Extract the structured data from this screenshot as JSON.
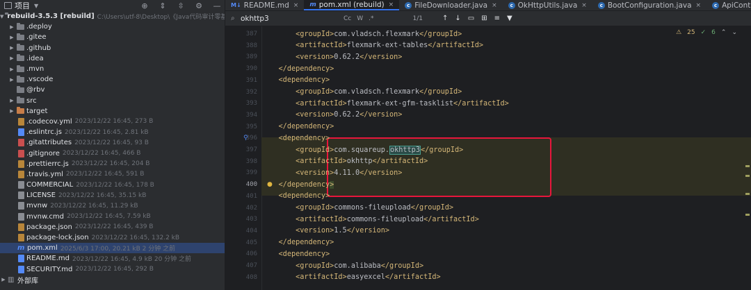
{
  "project_panel": {
    "title": "项目",
    "root": {
      "name": "rebuild-3.5.3 [rebuild]",
      "path": "C:\\Users\\utf-8\\Desktop\\《Java代码审计零基"
    },
    "items": [
      {
        "name": ".deploy",
        "kind": "folder",
        "meta": ""
      },
      {
        "name": ".gitee",
        "kind": "folder",
        "meta": ""
      },
      {
        "name": ".github",
        "kind": "folder",
        "meta": ""
      },
      {
        "name": ".idea",
        "kind": "folder",
        "meta": ""
      },
      {
        "name": ".mvn",
        "kind": "folder",
        "meta": ""
      },
      {
        "name": ".vscode",
        "kind": "folder",
        "meta": ""
      },
      {
        "name": "@rbv",
        "kind": "folder",
        "meta": ""
      },
      {
        "name": "src",
        "kind": "folder",
        "meta": ""
      },
      {
        "name": "target",
        "kind": "folder-orange",
        "meta": ""
      },
      {
        "name": ".codecov.yml",
        "kind": "file",
        "meta": "2023/12/22 16:45, 273 B"
      },
      {
        "name": ".eslintrc.js",
        "kind": "file",
        "meta": "2023/12/22 16:45, 2.81 kB"
      },
      {
        "name": ".gitattributes",
        "kind": "file",
        "meta": "2023/12/22 16:45, 93 B"
      },
      {
        "name": ".gitignore",
        "kind": "file",
        "meta": "2023/12/22 16:45, 466 B"
      },
      {
        "name": ".prettierrc.js",
        "kind": "file",
        "meta": "2023/12/22 16:45, 204 B"
      },
      {
        "name": ".travis.yml",
        "kind": "file",
        "meta": "2023/12/22 16:45, 591 B"
      },
      {
        "name": "COMMERCIAL",
        "kind": "file",
        "meta": "2023/12/22 16:45, 178 B"
      },
      {
        "name": "LICENSE",
        "kind": "file",
        "meta": "2023/12/22 16:45, 35.15 kB"
      },
      {
        "name": "mvnw",
        "kind": "file",
        "meta": "2023/12/22 16:45, 11.29 kB"
      },
      {
        "name": "mvnw.cmd",
        "kind": "file",
        "meta": "2023/12/22 16:45, 7.59 kB"
      },
      {
        "name": "package.json",
        "kind": "file",
        "meta": "2023/12/22 16:45, 439 B"
      },
      {
        "name": "package-lock.json",
        "kind": "file",
        "meta": "2023/12/22 16:45, 132.2 kB"
      },
      {
        "name": "pom.xml",
        "kind": "maven",
        "meta": "2025/6/3 17:00, 20.21 kB 2 分钟 之前"
      },
      {
        "name": "README.md",
        "kind": "file",
        "meta": "2023/12/22 16:45, 4.9 kB 20 分钟 之前"
      },
      {
        "name": "SECURITY.md",
        "kind": "file",
        "meta": "2023/12/22 16:45, 292 B"
      }
    ],
    "external_libs": "外部库"
  },
  "tabs": [
    {
      "label": "README.md",
      "icon": "md",
      "active": false
    },
    {
      "label": "pom.xml (rebuild)",
      "icon": "m",
      "active": true
    },
    {
      "label": "FileDownloader.java",
      "icon": "c",
      "active": false
    },
    {
      "label": "OkHttpUtils.java",
      "icon": "c",
      "active": false
    },
    {
      "label": "BootConfiguration.java",
      "icon": "c",
      "active": false
    },
    {
      "label": "ApiContext.java",
      "icon": "c",
      "active": false
    }
  ],
  "search": {
    "query": "okhttp3",
    "count": "1/1",
    "opt_case": "Cc",
    "opt_word": "W",
    "opt_regex": ".*"
  },
  "inspections": {
    "warnings": "25",
    "ok": "6"
  },
  "editor": {
    "lines": [
      {
        "n": "387",
        "indent": 2,
        "parts": [
          [
            "t",
            "<groupId>"
          ],
          [
            "x",
            "com.vladsch.flexmark"
          ],
          [
            "t",
            "</groupId>"
          ]
        ]
      },
      {
        "n": "388",
        "indent": 2,
        "parts": [
          [
            "t",
            "<artifactId>"
          ],
          [
            "x",
            "flexmark-ext-tables"
          ],
          [
            "t",
            "</artifactId>"
          ]
        ]
      },
      {
        "n": "389",
        "indent": 2,
        "parts": [
          [
            "t",
            "<version>"
          ],
          [
            "x",
            "0.62.2"
          ],
          [
            "t",
            "</version>"
          ]
        ]
      },
      {
        "n": "390",
        "indent": 1,
        "parts": [
          [
            "t",
            "</dependency>"
          ]
        ]
      },
      {
        "n": "391",
        "indent": 1,
        "parts": [
          [
            "t",
            "<dependency>"
          ]
        ]
      },
      {
        "n": "392",
        "indent": 2,
        "parts": [
          [
            "t",
            "<groupId>"
          ],
          [
            "x",
            "com.vladsch.flexmark"
          ],
          [
            "t",
            "</groupId>"
          ]
        ]
      },
      {
        "n": "393",
        "indent": 2,
        "parts": [
          [
            "t",
            "<artifactId>"
          ],
          [
            "x",
            "flexmark-ext-gfm-tasklist"
          ],
          [
            "t",
            "</artifactId>"
          ]
        ]
      },
      {
        "n": "394",
        "indent": 2,
        "parts": [
          [
            "t",
            "<version>"
          ],
          [
            "x",
            "0.62.2"
          ],
          [
            "t",
            "</version>"
          ]
        ]
      },
      {
        "n": "395",
        "indent": 1,
        "parts": [
          [
            "t",
            "</dependency>"
          ]
        ]
      },
      {
        "n": "396",
        "indent": 1,
        "parts": [
          [
            "t",
            "<dependency>"
          ]
        ]
      },
      {
        "n": "397",
        "indent": 2,
        "parts": [
          [
            "t",
            "<groupId>"
          ],
          [
            "x",
            "com.squareup."
          ],
          [
            "m",
            "okhttp3"
          ],
          [
            "t",
            "</groupId>"
          ]
        ]
      },
      {
        "n": "398",
        "indent": 2,
        "parts": [
          [
            "t",
            "<artifactId>"
          ],
          [
            "x",
            "okhttp"
          ],
          [
            "t",
            "</artifactId>"
          ]
        ]
      },
      {
        "n": "399",
        "indent": 2,
        "parts": [
          [
            "t",
            "<version>"
          ],
          [
            "x",
            "4.11.0"
          ],
          [
            "t",
            "</version>"
          ]
        ]
      },
      {
        "n": "400",
        "indent": 1,
        "parts": [
          [
            "t",
            "</dependency"
          ],
          [
            "c",
            ">"
          ]
        ]
      },
      {
        "n": "401",
        "indent": 1,
        "parts": [
          [
            "t",
            "<dependency>"
          ]
        ]
      },
      {
        "n": "402",
        "indent": 2,
        "parts": [
          [
            "t",
            "<groupId>"
          ],
          [
            "x",
            "commons-fileupload"
          ],
          [
            "t",
            "</groupId>"
          ]
        ]
      },
      {
        "n": "403",
        "indent": 2,
        "parts": [
          [
            "t",
            "<artifactId>"
          ],
          [
            "x",
            "commons-fileupload"
          ],
          [
            "t",
            "</artifactId>"
          ]
        ]
      },
      {
        "n": "404",
        "indent": 2,
        "parts": [
          [
            "t",
            "<version>"
          ],
          [
            "x",
            "1.5"
          ],
          [
            "t",
            "</version>"
          ]
        ]
      },
      {
        "n": "405",
        "indent": 1,
        "parts": [
          [
            "t",
            "</dependency>"
          ]
        ]
      },
      {
        "n": "406",
        "indent": 1,
        "parts": [
          [
            "t",
            "<dependency>"
          ]
        ]
      },
      {
        "n": "407",
        "indent": 2,
        "parts": [
          [
            "t",
            "<groupId>"
          ],
          [
            "x",
            "com.alibaba"
          ],
          [
            "t",
            "</groupId>"
          ]
        ]
      },
      {
        "n": "408",
        "indent": 2,
        "parts": [
          [
            "t",
            "<artifactId>"
          ],
          [
            "x",
            "easyexcel"
          ],
          [
            "t",
            "</artifactId>"
          ]
        ]
      }
    ],
    "top_partial": "<dependency>",
    "current_line": "400"
  },
  "colors": {
    "tag": "#d5b778",
    "text": "#bcbec4",
    "highlight_box": "#e8163b",
    "accent": "#3574f0"
  }
}
